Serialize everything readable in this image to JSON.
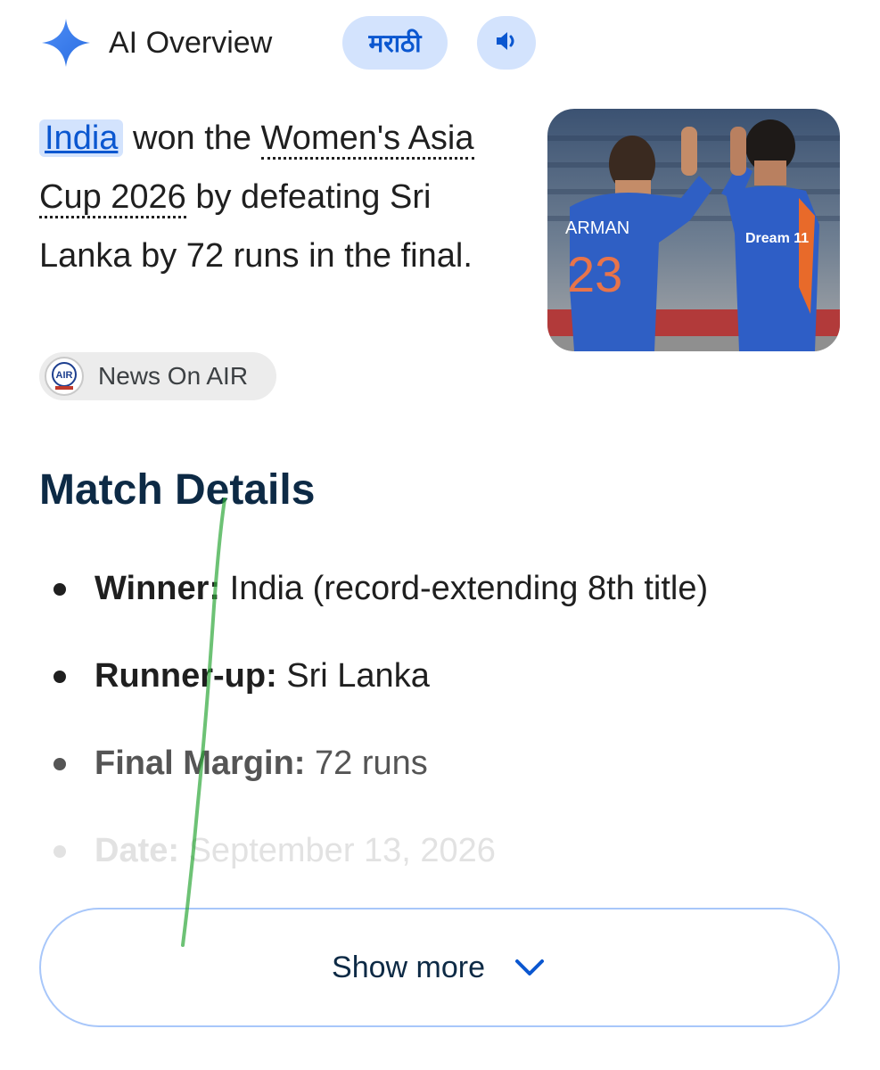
{
  "header": {
    "title": "AI Overview",
    "language_button": "मराठी",
    "icons": {
      "logo": "gemini-sparkle-icon",
      "audio": "speaker-icon"
    },
    "accent_color": "#0b57d0",
    "chip_color": "#d3e3fd"
  },
  "summary": {
    "link": "India",
    "text_1": " won the ",
    "term_1": "Women's Asia Cup 2026",
    "text_2": " by defeating Sri Lanka by 72 runs in the final."
  },
  "source": {
    "label": "News On AIR",
    "logo_text": "AIR"
  },
  "photo": {
    "jersey_name": "ARMAN",
    "jersey_number": "23",
    "sponsor": "Dream 11"
  },
  "match_details": {
    "title": "Match Details",
    "items": [
      {
        "label": "Winner:",
        "value": " India (record-extending 8th title)"
      },
      {
        "label": "Runner-up:",
        "value": " Sri Lanka"
      },
      {
        "label": "Final Margin:",
        "value": " 72 runs"
      },
      {
        "label": "Date:",
        "value": " September 13, 2026"
      }
    ]
  },
  "show_more": {
    "label": "Show more",
    "icon": "chevron-down-icon"
  }
}
